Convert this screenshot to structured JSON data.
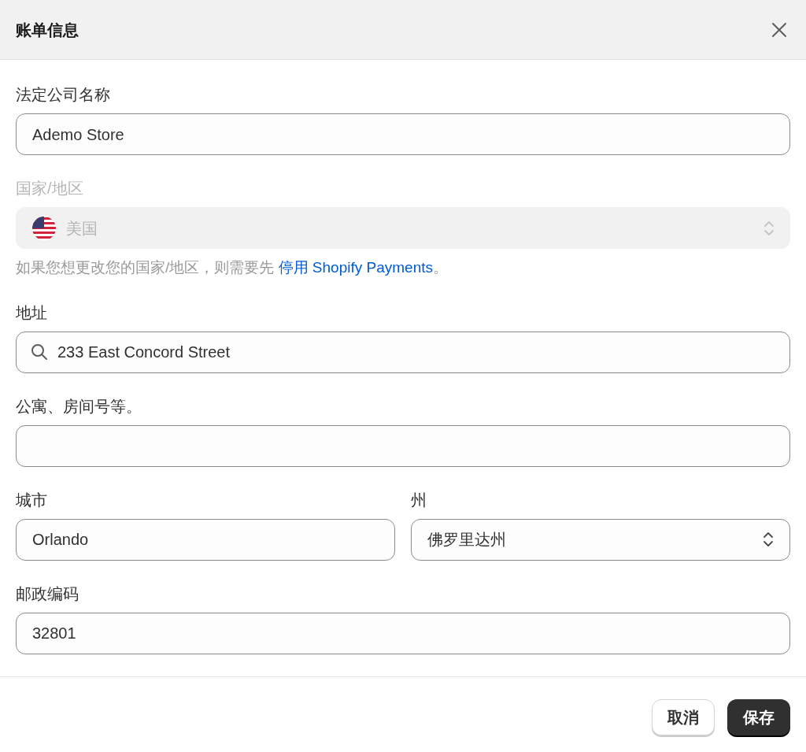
{
  "dialog": {
    "title": "账单信息"
  },
  "rows": [
    [
      {
        "kind": "text",
        "label": "法定公司名称",
        "value": "Ademo Store"
      }
    ],
    [
      {
        "kind": "select",
        "label": "国家/地区",
        "value": "美国",
        "disabled": true,
        "help": {
          "text": "如果您想更改您的国家/地区，则需要先 ",
          "link": "停用 Shopify Payments",
          "after": "。"
        }
      }
    ],
    [
      {
        "kind": "search",
        "label": "地址",
        "value": "233 East Concord Street"
      }
    ],
    [
      {
        "kind": "text",
        "label": "公寓、房间号等。"
      }
    ],
    [
      {
        "kind": "text",
        "label": "城市",
        "value": "Orlando"
      },
      {
        "kind": "select",
        "label": "州",
        "value": "佛罗里达州"
      }
    ],
    [
      {
        "kind": "text",
        "label": "邮政编码",
        "value": "32801"
      }
    ]
  ],
  "buttons": [
    {
      "label": "取消",
      "primary": false
    },
    {
      "label": "保存",
      "primary": true
    }
  ]
}
